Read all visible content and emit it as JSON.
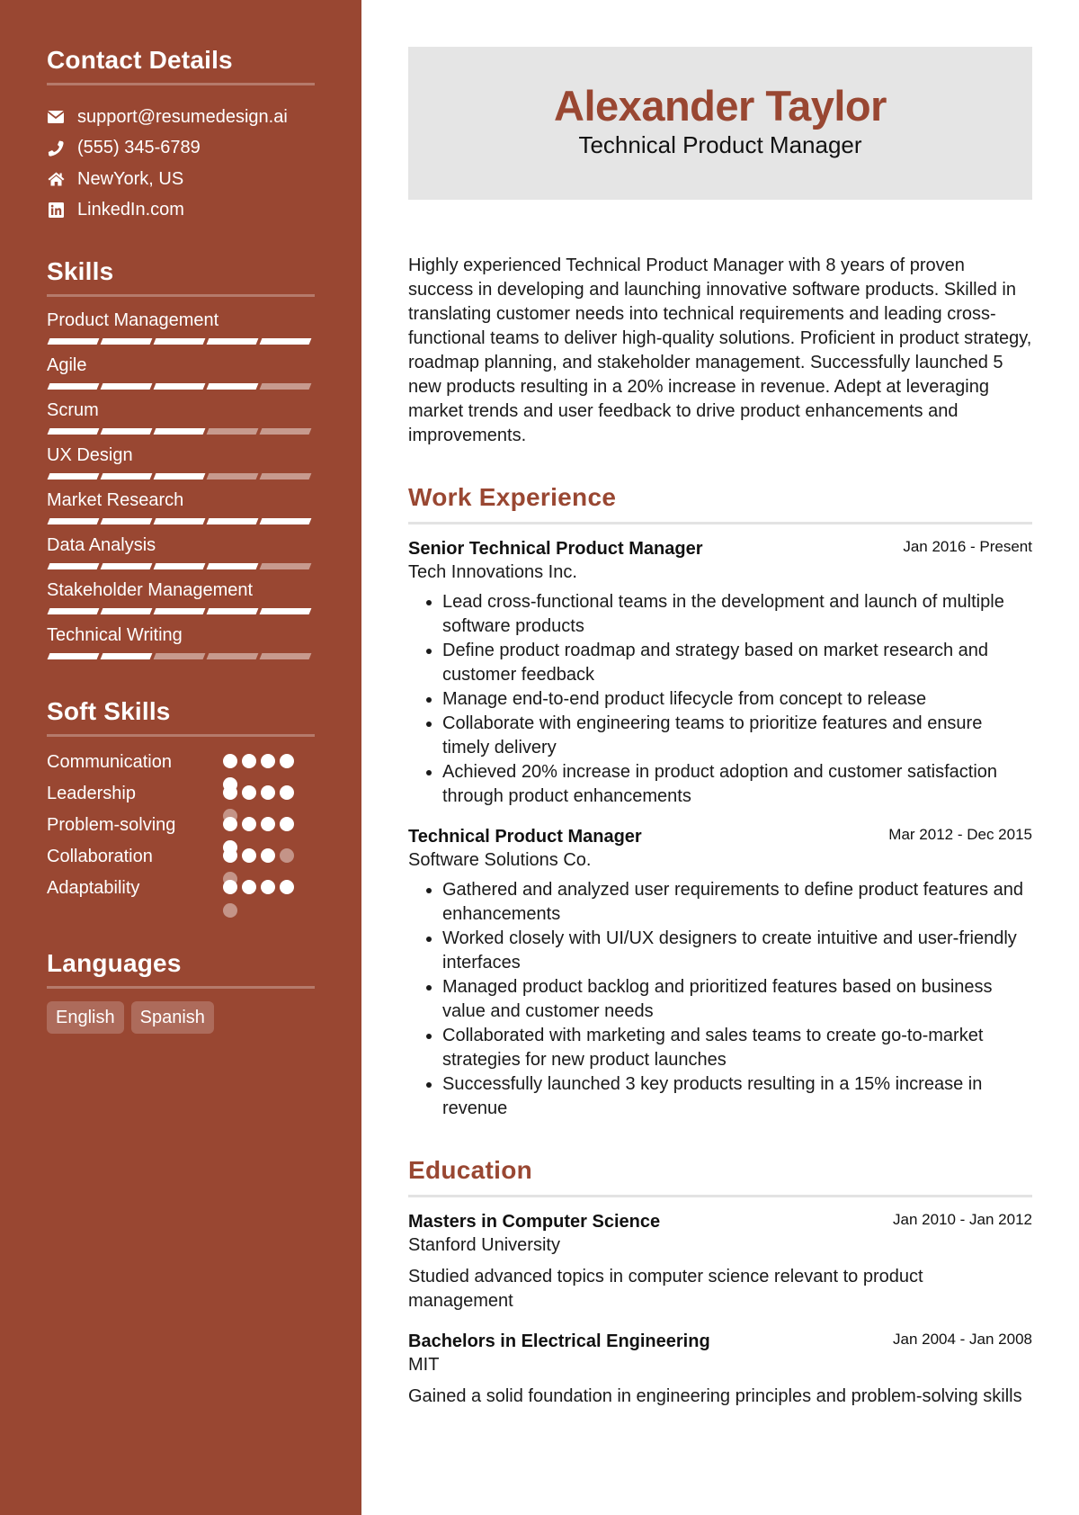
{
  "colors": {
    "accent": "#994732",
    "header_bg": "#e5e5e5"
  },
  "sidebar": {
    "contact": {
      "title": "Contact Details",
      "items": [
        {
          "icon": "envelope-icon",
          "text": "support@resumedesign.ai"
        },
        {
          "icon": "phone-icon",
          "text": "(555) 345-6789"
        },
        {
          "icon": "home-icon",
          "text": "NewYork, US"
        },
        {
          "icon": "linkedin-icon",
          "text": "LinkedIn.com"
        }
      ]
    },
    "skills": {
      "title": "Skills",
      "max_level": 5,
      "items": [
        {
          "name": "Product Management",
          "level": 5
        },
        {
          "name": "Agile",
          "level": 4
        },
        {
          "name": "Scrum",
          "level": 3
        },
        {
          "name": "UX Design",
          "level": 3
        },
        {
          "name": "Market Research",
          "level": 5
        },
        {
          "name": "Data Analysis",
          "level": 4
        },
        {
          "name": "Stakeholder Management",
          "level": 5
        },
        {
          "name": "Technical Writing",
          "level": 2
        }
      ]
    },
    "soft_skills": {
      "title": "Soft Skills",
      "max_level": 5,
      "items": [
        {
          "name": "Communication",
          "level": 5
        },
        {
          "name": "Leadership",
          "level": 4
        },
        {
          "name": "Problem-solving",
          "level": 5
        },
        {
          "name": "Collaboration",
          "level": 3
        },
        {
          "name": "Adaptability",
          "level": 4
        }
      ]
    },
    "languages": {
      "title": "Languages",
      "items": [
        "English",
        "Spanish"
      ]
    }
  },
  "header": {
    "name": "Alexander Taylor",
    "role": "Technical Product Manager"
  },
  "summary": "Highly experienced Technical Product Manager with 8 years of proven success in developing and launching innovative software products. Skilled in translating customer needs into technical requirements and leading cross-functional teams to deliver high-quality solutions. Proficient in product strategy, roadmap planning, and stakeholder management. Successfully launched 5 new products resulting in a 20% increase in revenue. Adept at leveraging market trends and user feedback to drive product enhancements and improvements.",
  "work": {
    "title": "Work Experience",
    "entries": [
      {
        "title": "Senior Technical Product Manager",
        "date": "Jan 2016 - Present",
        "org": "Tech Innovations Inc.",
        "bullets": [
          "Lead cross-functional teams in the development and launch of multiple software products",
          "Define product roadmap and strategy based on market research and customer feedback",
          "Manage end-to-end product lifecycle from concept to release",
          "Collaborate with engineering teams to prioritize features and ensure timely delivery",
          "Achieved 20% increase in product adoption and customer satisfaction through product enhancements"
        ]
      },
      {
        "title": "Technical Product Manager",
        "date": "Mar 2012 - Dec 2015",
        "org": "Software Solutions Co.",
        "bullets": [
          "Gathered and analyzed user requirements to define product features and enhancements",
          "Worked closely with UI/UX designers to create intuitive and user-friendly interfaces",
          "Managed product backlog and prioritized features based on business value and customer needs",
          "Collaborated with marketing and sales teams to create go-to-market strategies for new product launches",
          "Successfully launched 3 key products resulting in a 15% increase in revenue"
        ]
      }
    ]
  },
  "education": {
    "title": "Education",
    "entries": [
      {
        "title": "Masters in Computer Science",
        "date": "Jan 2010 - Jan 2012",
        "org": "Stanford University",
        "desc": "Studied advanced topics in computer science relevant to product management"
      },
      {
        "title": "Bachelors in Electrical Engineering",
        "date": "Jan 2004 - Jan 2008",
        "org": "MIT",
        "desc": "Gained a solid foundation in engineering principles and problem-solving skills"
      }
    ]
  }
}
